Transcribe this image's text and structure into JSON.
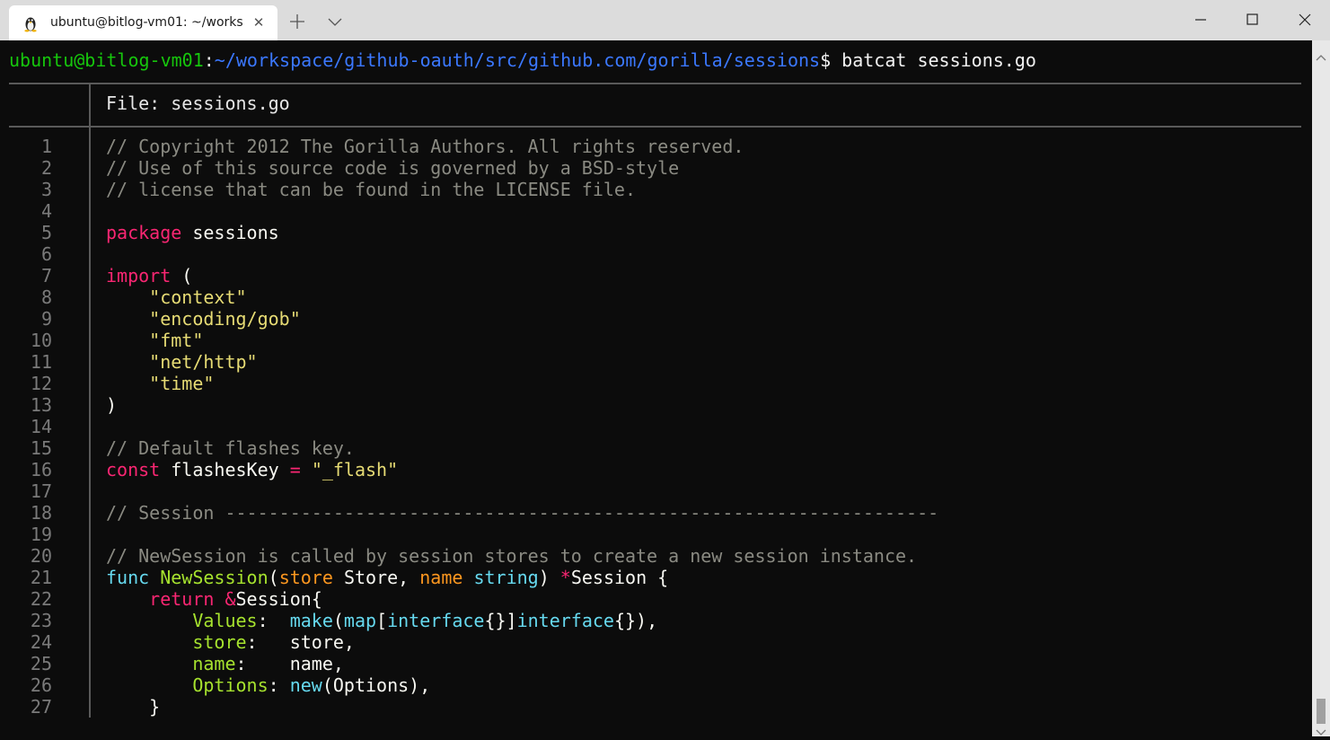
{
  "window": {
    "tab_title": "ubuntu@bitlog-vm01: ~/works",
    "tab_icon": "linux-penguin-icon",
    "close_tab_glyph": "✕",
    "new_tab_icon": "plus-icon",
    "dropdown_icon": "chevron-down-icon",
    "minimize_icon": "minimize-icon",
    "maximize_icon": "maximize-icon",
    "close_icon": "close-icon"
  },
  "prompt": {
    "user_host": "ubuntu@bitlog-vm01",
    "separator": ":",
    "path": "~/workspace/github-oauth/src/github.com/gorilla/sessions",
    "symbol": "$",
    "command": " batcat sessions.go"
  },
  "file_header": {
    "label": "File: ",
    "filename": "sessions.go"
  },
  "line_numbers": [
    "1",
    "2",
    "3",
    "4",
    "5",
    "6",
    "7",
    "8",
    "9",
    "10",
    "11",
    "12",
    "13",
    "14",
    "15",
    "16",
    "17",
    "18",
    "19",
    "20",
    "21",
    "22",
    "23",
    "24",
    "25",
    "26",
    "27"
  ],
  "code_lines": [
    [
      {
        "t": "// Copyright 2012 The Gorilla Authors. All rights reserved.",
        "c": "comment"
      }
    ],
    [
      {
        "t": "// Use of this source code is governed by a BSD-style",
        "c": "comment"
      }
    ],
    [
      {
        "t": "// license that can be found in the LICENSE file.",
        "c": "comment"
      }
    ],
    [],
    [
      {
        "t": "package",
        "c": "kw"
      },
      {
        "t": " sessions",
        "c": "plain"
      }
    ],
    [],
    [
      {
        "t": "import",
        "c": "kw"
      },
      {
        "t": " (",
        "c": "plain"
      }
    ],
    [
      {
        "t": "    ",
        "c": "plain"
      },
      {
        "t": "\"context\"",
        "c": "str"
      }
    ],
    [
      {
        "t": "    ",
        "c": "plain"
      },
      {
        "t": "\"encoding/gob\"",
        "c": "str"
      }
    ],
    [
      {
        "t": "    ",
        "c": "plain"
      },
      {
        "t": "\"fmt\"",
        "c": "str"
      }
    ],
    [
      {
        "t": "    ",
        "c": "plain"
      },
      {
        "t": "\"net/http\"",
        "c": "str"
      }
    ],
    [
      {
        "t": "    ",
        "c": "plain"
      },
      {
        "t": "\"time\"",
        "c": "str"
      }
    ],
    [
      {
        "t": ")",
        "c": "plain"
      }
    ],
    [],
    [
      {
        "t": "// Default flashes key.",
        "c": "comment"
      }
    ],
    [
      {
        "t": "const",
        "c": "kw"
      },
      {
        "t": " flashesKey ",
        "c": "plain"
      },
      {
        "t": "=",
        "c": "kw"
      },
      {
        "t": " ",
        "c": "plain"
      },
      {
        "t": "\"_flash\"",
        "c": "str"
      }
    ],
    [],
    [
      {
        "t": "// Session ------------------------------------------------------------------",
        "c": "comment"
      }
    ],
    [],
    [
      {
        "t": "// NewSession is called by session stores to create a new session instance.",
        "c": "comment"
      }
    ],
    [
      {
        "t": "func",
        "c": "type"
      },
      {
        "t": " ",
        "c": "plain"
      },
      {
        "t": "NewSession",
        "c": "fn"
      },
      {
        "t": "(",
        "c": "plain"
      },
      {
        "t": "store",
        "c": "param"
      },
      {
        "t": " Store, ",
        "c": "plain"
      },
      {
        "t": "name",
        "c": "param"
      },
      {
        "t": " ",
        "c": "plain"
      },
      {
        "t": "string",
        "c": "type"
      },
      {
        "t": ") ",
        "c": "plain"
      },
      {
        "t": "*",
        "c": "kw"
      },
      {
        "t": "Session {",
        "c": "plain"
      }
    ],
    [
      {
        "t": "    ",
        "c": "plain"
      },
      {
        "t": "return",
        "c": "kw"
      },
      {
        "t": " ",
        "c": "plain"
      },
      {
        "t": "&",
        "c": "kw"
      },
      {
        "t": "Session{",
        "c": "plain"
      }
    ],
    [
      {
        "t": "        ",
        "c": "plain"
      },
      {
        "t": "Values",
        "c": "field"
      },
      {
        "t": ":  ",
        "c": "plain"
      },
      {
        "t": "make",
        "c": "type"
      },
      {
        "t": "(",
        "c": "plain"
      },
      {
        "t": "map",
        "c": "type"
      },
      {
        "t": "[",
        "c": "plain"
      },
      {
        "t": "interface",
        "c": "type"
      },
      {
        "t": "{}]",
        "c": "plain"
      },
      {
        "t": "interface",
        "c": "type"
      },
      {
        "t": "{}),",
        "c": "plain"
      }
    ],
    [
      {
        "t": "        ",
        "c": "plain"
      },
      {
        "t": "store",
        "c": "field"
      },
      {
        "t": ":   store,",
        "c": "plain"
      }
    ],
    [
      {
        "t": "        ",
        "c": "plain"
      },
      {
        "t": "name",
        "c": "field"
      },
      {
        "t": ":    name,",
        "c": "plain"
      }
    ],
    [
      {
        "t": "        ",
        "c": "plain"
      },
      {
        "t": "Options",
        "c": "field"
      },
      {
        "t": ": ",
        "c": "plain"
      },
      {
        "t": "new",
        "c": "type"
      },
      {
        "t": "(Options),",
        "c": "plain"
      }
    ],
    [
      {
        "t": "    }",
        "c": "plain"
      }
    ]
  ],
  "colors": {
    "terminal_bg": "#0c0c0c",
    "user_host": "#16c60c",
    "path": "#3b78ff",
    "keyword": "#f92672",
    "string": "#e6db74",
    "comment": "#8a8a82",
    "function": "#a6e22e",
    "type": "#66d9ef",
    "parameter": "#fd971f",
    "line_number": "#7a7a7a"
  },
  "scrollbar": {
    "up_icon": "scroll-up-arrow-icon",
    "down_icon": "scroll-down-arrow-icon"
  }
}
